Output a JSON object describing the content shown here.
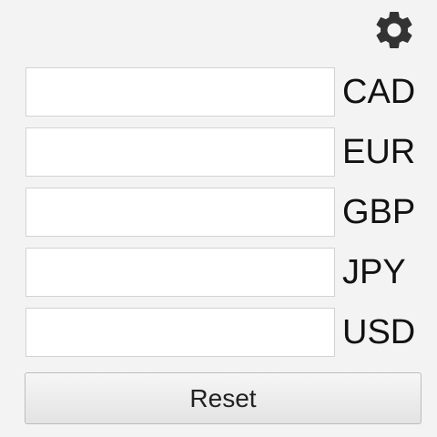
{
  "header": {
    "settings_icon": "gear-icon"
  },
  "currencies": [
    {
      "code": "CAD",
      "value": "",
      "placeholder": ""
    },
    {
      "code": "EUR",
      "value": "",
      "placeholder": ""
    },
    {
      "code": "GBP",
      "value": "",
      "placeholder": ""
    },
    {
      "code": "JPY",
      "value": "",
      "placeholder": ""
    },
    {
      "code": "USD",
      "value": "",
      "placeholder": ""
    }
  ],
  "actions": {
    "reset_label": "Reset"
  },
  "colors": {
    "background": "#f3f3f3",
    "field": "#ffffff",
    "icon": "#333333"
  }
}
